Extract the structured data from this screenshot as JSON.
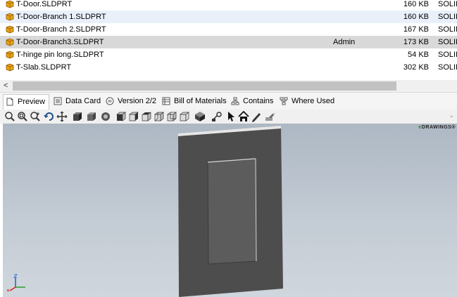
{
  "files": [
    {
      "name": "T-Door.SLDPRT",
      "user": "",
      "size": "160 KB",
      "type": "SOLID",
      "state": "normal"
    },
    {
      "name": "T-Door-Branch 1.SLDPRT",
      "user": "",
      "size": "160 KB",
      "type": "SOLID",
      "state": "hover"
    },
    {
      "name": "T-Door-Branch 2.SLDPRT",
      "user": "",
      "size": "167 KB",
      "type": "SOLID",
      "state": "normal"
    },
    {
      "name": "T-Door-Branch3.SLDPRT",
      "user": "Admin",
      "size": "173 KB",
      "type": "SOLID",
      "state": "selected"
    },
    {
      "name": "T-hinge pin long.SLDPRT",
      "user": "",
      "size": "54 KB",
      "type": "SOLID",
      "state": "normal"
    },
    {
      "name": "T-Slab.SLDPRT",
      "user": "",
      "size": "302 KB",
      "type": "SOLID",
      "state": "normal"
    }
  ],
  "scrollbar": {
    "left_arrow": "<"
  },
  "tabs": [
    {
      "label": "Preview",
      "icon": "preview-icon",
      "active": true
    },
    {
      "label": "Data Card",
      "icon": "data-card-icon"
    },
    {
      "label": "Version 2/2",
      "icon": "version-icon"
    },
    {
      "label": "Bill of Materials",
      "icon": "bom-icon"
    },
    {
      "label": "Contains",
      "icon": "contains-icon"
    },
    {
      "label": "Where Used",
      "icon": "where-used-icon"
    }
  ],
  "toolbar_icons": [
    "zoom-fit-icon",
    "zoom-area-icon",
    "zoom-in-out-icon",
    "rotate-icon",
    "pan-icon",
    "shaded-edges-icon",
    "shaded-icon",
    "render-icon",
    "view-front-icon",
    "view-back-icon",
    "view-left-icon",
    "view-right-icon",
    "view-top-icon",
    "view-bottom-icon",
    "view-iso-icon",
    "measure-icon",
    "select-icon",
    "home-icon",
    "markup-pen-icon",
    "options-icon"
  ],
  "viewer": {
    "logo_prefix": "e",
    "logo_text": "DRAWINGS",
    "logo_suffix": "®"
  },
  "colors": {
    "selected_row": "#d9d9d9",
    "hover_row": "#e9f0fa",
    "model_face": "#4d4d4d"
  }
}
